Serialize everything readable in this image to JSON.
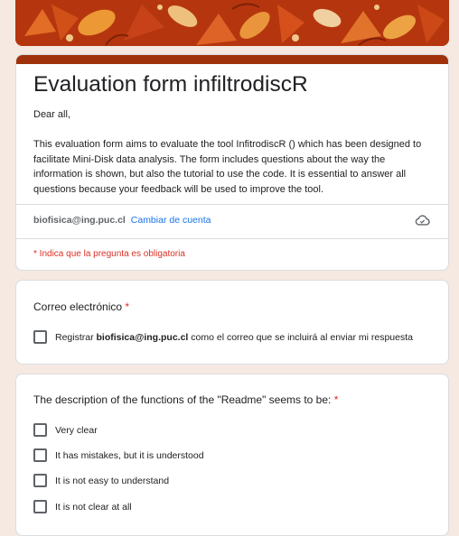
{
  "header": {
    "title": "Evaluation form infiltrodiscR",
    "greeting": "Dear all,",
    "description": "This evaluation form aims to evaluate the tool InfitrodiscR () which has been designed to facilitate Mini-Disk data analysis. The form includes questions about the way the information is shown, but also the tutorial to use the code. It is essential to answer all questions because your feedback will be used to improve the tool.",
    "account_email": "biofisica@ing.puc.cl",
    "switch_account": "Cambiar de cuenta",
    "required_note": "* Indica que la pregunta es obligatoria"
  },
  "email_question": {
    "label": "Correo electrónico",
    "required_mark": "*",
    "option_prefix": "Registrar ",
    "option_email": "biofisica@ing.puc.cl",
    "option_suffix": " como el correo que se incluirá al enviar mi respuesta"
  },
  "question1": {
    "label": "The description of the functions of the \"Readme\" seems to be:",
    "required_mark": "*",
    "options": [
      "Very clear",
      "It has mistakes, but it is understood",
      "It is not easy to understand",
      "It is not clear at all"
    ]
  },
  "colors": {
    "theme": "#a0320b",
    "accent_link": "#1a73e8",
    "required": "#d93025",
    "background": "#f5e9e2"
  }
}
